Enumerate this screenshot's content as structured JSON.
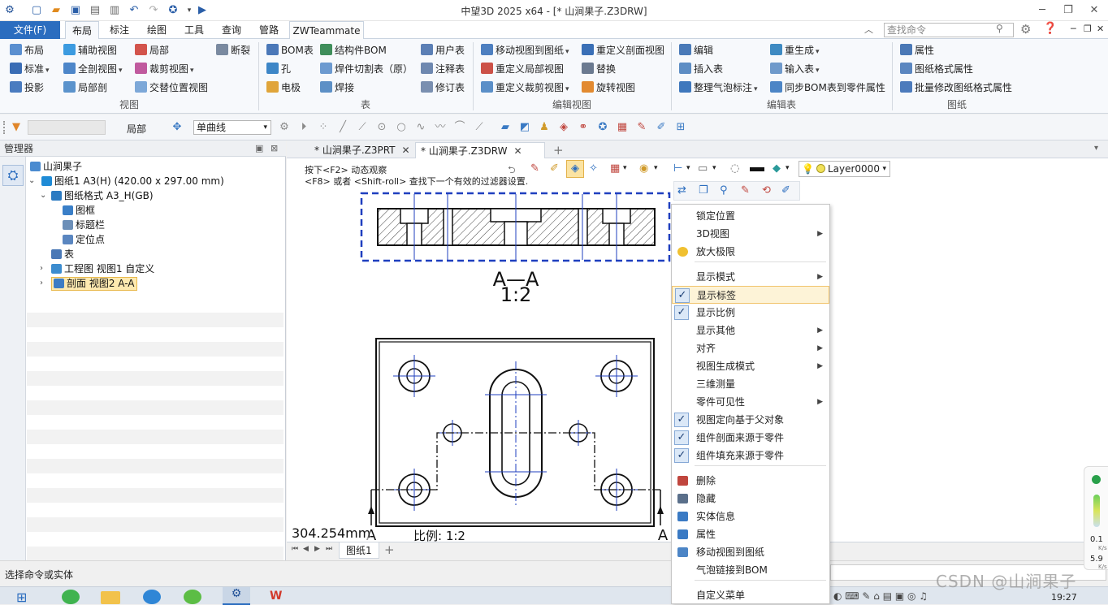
{
  "window": {
    "title": "中望3D 2025 x64 - [* 山涧果子.Z3DRW]"
  },
  "ribbon_tabs": [
    "文件(F)",
    "布局",
    "标注",
    "绘图",
    "工具",
    "查询",
    "管路",
    "ZWTeammate"
  ],
  "search": {
    "placeholder": "查找命令"
  },
  "ribbon": {
    "view": {
      "label": "视图",
      "items": [
        "布局",
        "辅助视图",
        "局部",
        "断裂",
        "标准",
        "全剖视图",
        "裁剪视图",
        "投影",
        "局部剖",
        "交替位置视图"
      ]
    },
    "table": {
      "label": "表",
      "items": [
        "BOM表",
        "结构件BOM",
        "用户表",
        "孔",
        "焊件切割表（原）",
        "注释表",
        "电极",
        "焊接",
        "修订表"
      ]
    },
    "edit_view": {
      "label": "编辑视图",
      "items": [
        "移动视图到图纸",
        "重定义剖面视图",
        "重定义局部视图",
        "替换",
        "重定义裁剪视图",
        "旋转视图"
      ]
    },
    "edit_table": {
      "label": "编辑表",
      "items": [
        "编辑",
        "重生成",
        "插入表",
        "输入表",
        "整理气泡标注",
        "同步BOM表到零件属性"
      ]
    },
    "sheet": {
      "label": "图纸",
      "items": [
        "属性",
        "图纸格式属性",
        "批量修改图纸格式属性"
      ]
    }
  },
  "toolbar2": {
    "scope": "局部",
    "curve_mode": "单曲线"
  },
  "manager": {
    "title": "管理器",
    "tree": [
      {
        "label": "山涧果子",
        "level": 0
      },
      {
        "label": "图纸1 A3(H) (420.00 x 297.00 mm)",
        "level": 1
      },
      {
        "label": "图纸格式 A3_H(GB)",
        "level": 2
      },
      {
        "label": "图框",
        "level": 3
      },
      {
        "label": "标题栏",
        "level": 3
      },
      {
        "label": "定位点",
        "level": 3
      },
      {
        "label": "表",
        "level": 2
      },
      {
        "label": "工程图 视图1 自定义",
        "level": 2
      },
      {
        "label": "剖面 视图2 A-A",
        "level": 2
      }
    ]
  },
  "doc_tabs": [
    "* 山涧果子.Z3PRT",
    "* 山涧果子.Z3DRW"
  ],
  "canvas": {
    "hint1": "按下<F2> 动态观察",
    "hint2": "<F8> 或者 <Shift-roll> 查找下一个有效的过滤器设置.",
    "layer": "Layer0000",
    "section_label": "A—A",
    "section_scale": "1:2",
    "cutting_mark_left": "A",
    "cutting_mark_right": "A",
    "distance": "304.254mm",
    "scale_text": "比例:   1:2"
  },
  "sheet_tabs": [
    "图纸1"
  ],
  "status": {
    "prompt": "选择命令或实体"
  },
  "context_menu": [
    {
      "label": "锁定位置",
      "arrow": false,
      "checked": false
    },
    {
      "label": "3D视图",
      "arrow": true,
      "checked": false
    },
    {
      "label": "放大极限",
      "arrow": false,
      "checked": false
    },
    {
      "label": "显示模式",
      "arrow": true,
      "checked": false
    },
    {
      "label": "显示标签",
      "arrow": false,
      "checked": true
    },
    {
      "label": "显示比例",
      "arrow": false,
      "checked": true
    },
    {
      "label": "显示其他",
      "arrow": true,
      "checked": false
    },
    {
      "label": "对齐",
      "arrow": true,
      "checked": false
    },
    {
      "label": "视图生成模式",
      "arrow": true,
      "checked": false
    },
    {
      "label": "三维测量",
      "arrow": false,
      "checked": false
    },
    {
      "label": "零件可见性",
      "arrow": true,
      "checked": false
    },
    {
      "label": "视图定向基于父对象",
      "arrow": false,
      "checked": true
    },
    {
      "label": "组件剖面来源于零件",
      "arrow": false,
      "checked": true
    },
    {
      "label": "组件填充来源于零件",
      "arrow": false,
      "checked": true
    },
    {
      "label": "删除",
      "arrow": false,
      "checked": false
    },
    {
      "label": "隐藏",
      "arrow": false,
      "checked": false
    },
    {
      "label": "实体信息",
      "arrow": false,
      "checked": false
    },
    {
      "label": "属性",
      "arrow": false,
      "checked": false
    },
    {
      "label": "移动视图到图纸",
      "arrow": false,
      "checked": false
    },
    {
      "label": "气泡链接到BOM",
      "arrow": false,
      "checked": false
    },
    {
      "label": "自定义菜单",
      "arrow": false,
      "checked": false
    }
  ],
  "net_gauge": {
    "up": "0.1",
    "up_unit": "K/s",
    "down": "5.9",
    "down_unit": "K/s"
  },
  "clock": "19:27",
  "watermark": "CSDN @山涧果子"
}
